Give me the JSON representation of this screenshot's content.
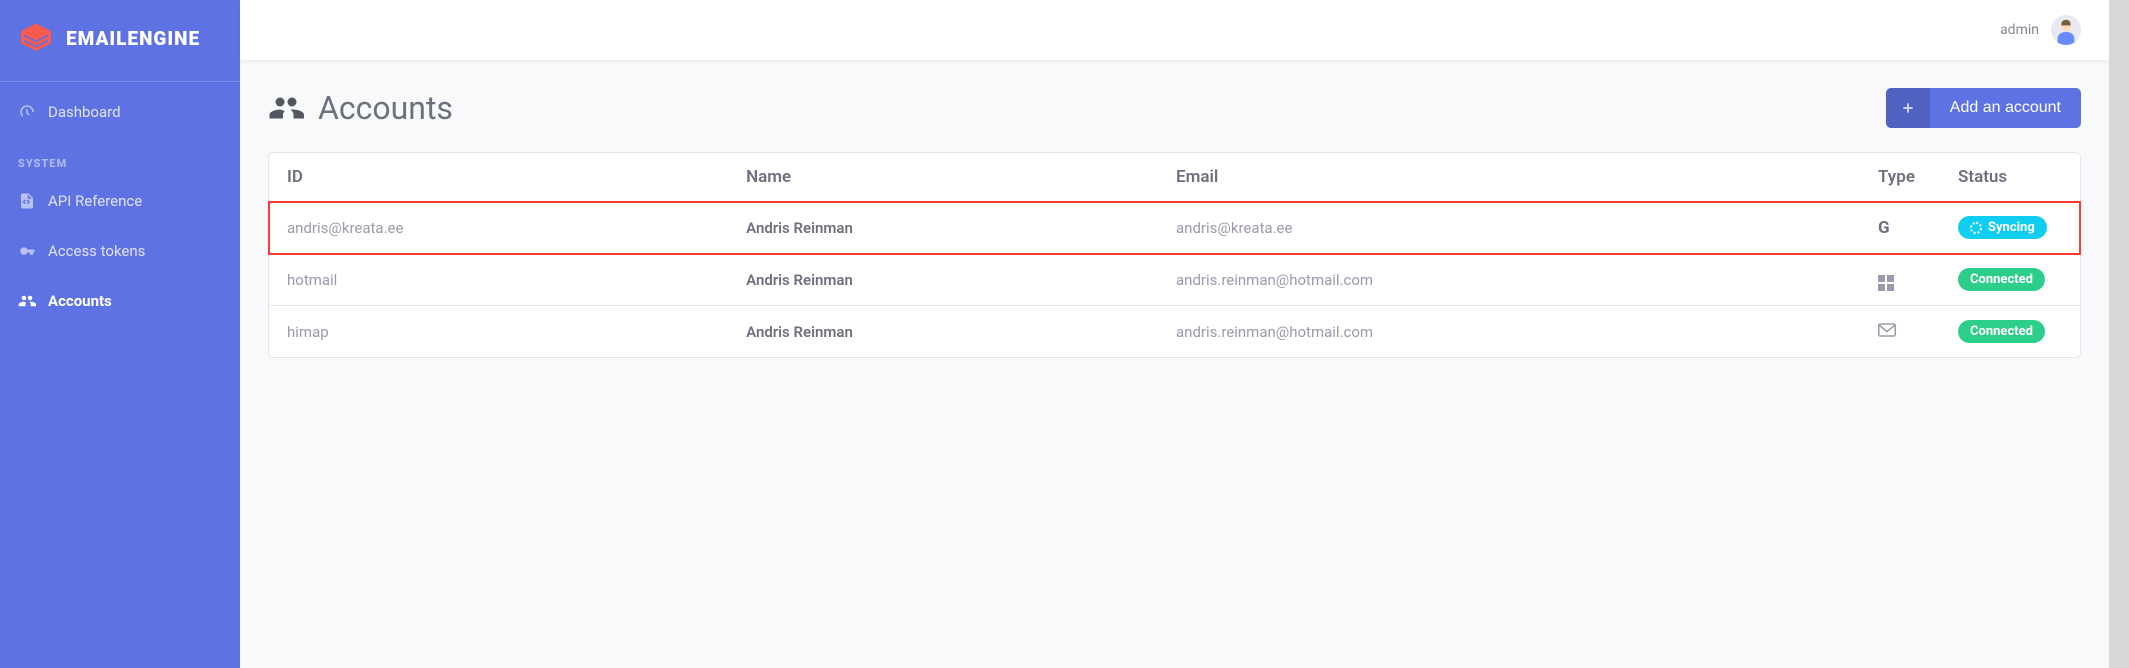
{
  "brand": {
    "name": "EMAILENGINE"
  },
  "sidebar": {
    "items": [
      {
        "label": "Dashboard",
        "icon": "dashboard"
      }
    ],
    "section_label": "SYSTEM",
    "system_items": [
      {
        "label": "API Reference",
        "icon": "file-code"
      },
      {
        "label": "Access tokens",
        "icon": "key"
      },
      {
        "label": "Accounts",
        "icon": "users",
        "active": true
      }
    ]
  },
  "topbar": {
    "username": "admin"
  },
  "page": {
    "title": "Accounts",
    "add_button": "Add an account"
  },
  "table": {
    "columns": [
      "ID",
      "Name",
      "Email",
      "Type",
      "Status"
    ],
    "rows": [
      {
        "id": "andris@kreata.ee",
        "name": "Andris Reinman",
        "email": "andris@kreata.ee",
        "type": "google",
        "status": "Syncing",
        "highlighted": true
      },
      {
        "id": "hotmail",
        "name": "Andris Reinman",
        "email": "andris.reinman@hotmail.com",
        "type": "microsoft",
        "status": "Connected"
      },
      {
        "id": "himap",
        "name": "Andris Reinman",
        "email": "andris.reinman@hotmail.com",
        "type": "imap",
        "status": "Connected"
      }
    ]
  }
}
